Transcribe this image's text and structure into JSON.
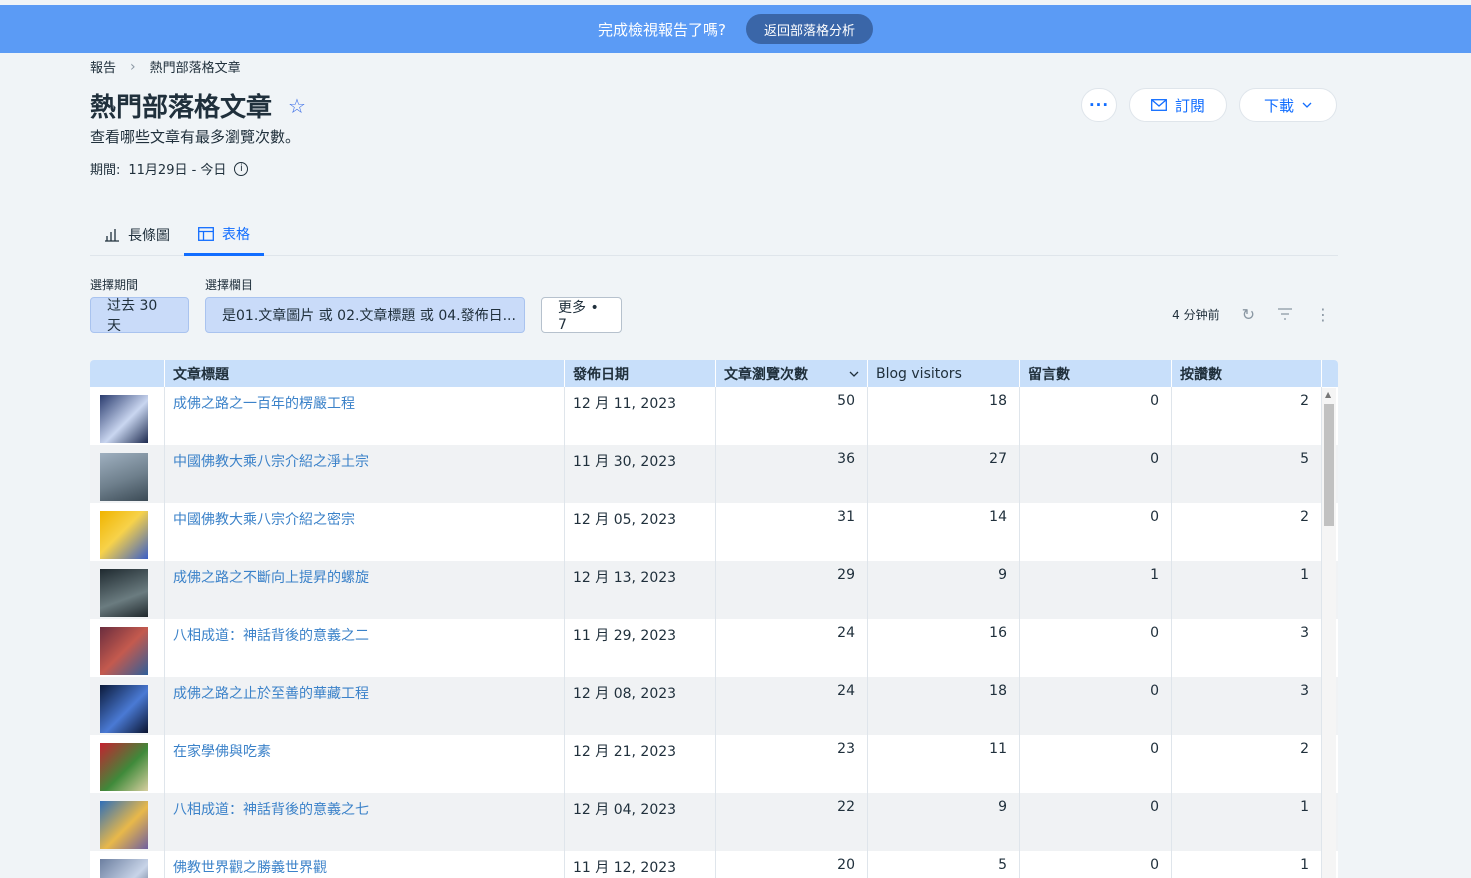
{
  "banner": {
    "message": "完成檢視報告了嗎?",
    "button": "返回部落格分析"
  },
  "breadcrumb": {
    "root": "報告",
    "current": "熱門部落格文章"
  },
  "header": {
    "title": "熱門部落格文章",
    "subtitle": "查看哪些文章有最多瀏覽次數。",
    "period_label": "期間:",
    "period_value": "11月29日 - 今日",
    "more_label": "···",
    "subscribe_label": "訂閱",
    "download_label": "下載"
  },
  "tabs": [
    {
      "label": "長條圖"
    },
    {
      "label": "表格"
    }
  ],
  "filters": {
    "period_label": "選擇期間",
    "period_value": "过去 30 天",
    "columns_label": "選擇欄目",
    "columns_value": "是01.文章圖片 或 02.文章標題 或 04.發佈日...",
    "more_value": "更多 • 7"
  },
  "toolbar": {
    "updated": "4 分钟前"
  },
  "table": {
    "headers": [
      "",
      "文章標題",
      "發佈日期",
      "文章瀏覽次數",
      "Blog visitors",
      "留言數",
      "按讚數"
    ],
    "rows": [
      {
        "title": "成佛之路之一百年的楞嚴工程",
        "date": "12 月 11, 2023",
        "views": "50",
        "visitors": "18",
        "comments": "0",
        "likes": "2"
      },
      {
        "title": "中國佛教大乘八宗介紹之淨土宗",
        "date": "11 月 30, 2023",
        "views": "36",
        "visitors": "27",
        "comments": "0",
        "likes": "5"
      },
      {
        "title": "中國佛教大乘八宗介紹之密宗",
        "date": "12 月 05, 2023",
        "views": "31",
        "visitors": "14",
        "comments": "0",
        "likes": "2"
      },
      {
        "title": "成佛之路之不斷向上提昇的螺旋",
        "date": "12 月 13, 2023",
        "views": "29",
        "visitors": "9",
        "comments": "1",
        "likes": "1"
      },
      {
        "title": "八相成道：神話背後的意義之二",
        "date": "11 月 29, 2023",
        "views": "24",
        "visitors": "16",
        "comments": "0",
        "likes": "3"
      },
      {
        "title": "成佛之路之止於至善的華藏工程",
        "date": "12 月 08, 2023",
        "views": "24",
        "visitors": "18",
        "comments": "0",
        "likes": "3"
      },
      {
        "title": "在家學佛與吃素",
        "date": "12 月 21, 2023",
        "views": "23",
        "visitors": "11",
        "comments": "0",
        "likes": "2"
      },
      {
        "title": "八相成道：神話背後的意義之七",
        "date": "12 月 04, 2023",
        "views": "22",
        "visitors": "9",
        "comments": "0",
        "likes": "1"
      },
      {
        "title": "佛教世界觀之勝義世界觀",
        "date": "11 月 12, 2023",
        "views": "20",
        "visitors": "5",
        "comments": "0",
        "likes": "1"
      }
    ]
  }
}
